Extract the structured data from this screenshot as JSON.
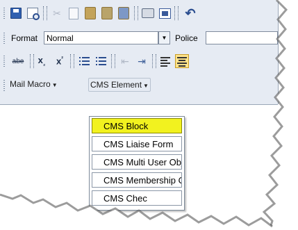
{
  "toolbar": {
    "format_label": "Format",
    "format_value": "Normal",
    "font_label": "Police",
    "strike_label": "abe",
    "subscript_label": "x",
    "subscript_mark": "₂",
    "superscript_label": "x",
    "superscript_mark": "²",
    "mail_macro_label": "Mail Macro",
    "cms_element_label": "CMS Element"
  },
  "dropdown": {
    "items": [
      {
        "label": "CMS Block",
        "highlighted": true
      },
      {
        "label": "CMS Liaise Form"
      },
      {
        "label": "CMS Multi User Object"
      },
      {
        "label": "CMS Membership Object"
      },
      {
        "label": "CMS Chec"
      }
    ]
  },
  "colors": {
    "toolbar_bg": "#e6ebf3",
    "highlight": "#f2f21f",
    "active_button": "#ffe38a"
  }
}
